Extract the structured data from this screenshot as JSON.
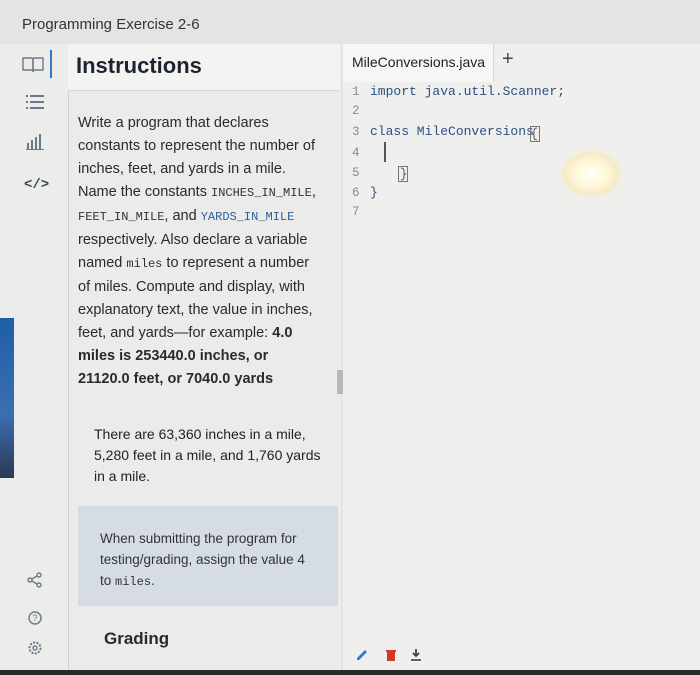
{
  "window": {
    "title": "Programming Exercise 2-6"
  },
  "rail": {
    "icons": [
      "list-icon",
      "chart-icon",
      "code-icon",
      "share-icon",
      "help-icon",
      "settings-icon"
    ]
  },
  "instructions": {
    "title": "Instructions",
    "p1_a": "Write a program that declares constants to represent the number of inches, feet, and yards in a mile. Name the constants",
    "const1": "INCHES_IN_MILE",
    "sep1": ",",
    "const2": "FEET_IN_MILE",
    "sep2": ",",
    "and": "and",
    "const3": "YARDS_IN_MILE",
    "p1_b": "respectively. Also declare a variable named",
    "var1": "miles",
    "p1_c": "to represent a number of miles. Compute and display, with explanatory text, the value in inches, feet, and yards—for example:",
    "example": "4.0 miles is 253440.0 inches, or 21120.0 feet, or 7040.0 yards",
    "p2": "There are 63,360 inches in a mile, 5,280 feet in a mile, and 1,760 yards in a mile.",
    "note_a": "When submitting the program for testing/grading, assign the value 4 to",
    "note_var": "miles",
    "note_end": ".",
    "grading": "Grading"
  },
  "editor": {
    "tab_label": "MileConversions.java",
    "add_tab": "+",
    "lines": [
      {
        "n": "1",
        "code": "import java.util.Scanner;"
      },
      {
        "n": "2",
        "code": ""
      },
      {
        "n": "3",
        "code": "class MileConversions "
      },
      {
        "n": "4",
        "code": ""
      },
      {
        "n": "5",
        "code": ""
      },
      {
        "n": "6",
        "code": "}"
      },
      {
        "n": "7",
        "code": ""
      }
    ]
  }
}
